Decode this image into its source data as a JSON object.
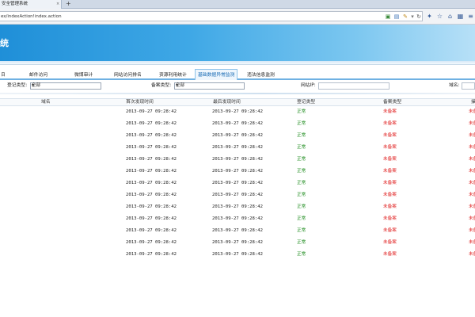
{
  "browser": {
    "tab_title": "安全管理系统",
    "tab_close": "×",
    "new_tab": "+",
    "url": "ex/indexAction!index.action",
    "icons": [
      "shield-icon",
      "bookmark-icon",
      "extension-icon",
      "reload-icon",
      "search-icon",
      "bird-icon",
      "star-icon",
      "home-icon",
      "clipboard-icon",
      "menu-icon"
    ]
  },
  "header": {
    "title": "统",
    "accent": "#2a9be0"
  },
  "nav": {
    "tabs": [
      {
        "label": "日"
      },
      {
        "label": "邮件访问"
      },
      {
        "label": "微博审计"
      },
      {
        "label": "网站访问排名"
      },
      {
        "label": "资源利用统计"
      },
      {
        "label": "基础数据异常监测"
      },
      {
        "label": "违法信息监测"
      }
    ],
    "active_index": 5
  },
  "filters": {
    "reg_type_label": "登记类型:",
    "reg_type_value": "全部",
    "filing_type_label": "备案类型:",
    "filing_type_value": "全部",
    "site_ip_label": "网站IP:",
    "domain_label": "域名:"
  },
  "table": {
    "headers": [
      "域名",
      "首次发现时间",
      "最后发现时间",
      "登记类型",
      "备案类型",
      "操"
    ],
    "rows": [
      {
        "first": "2013-09-27 09:28:42",
        "last": "2013-09-27 09:28:42",
        "reg": "正常",
        "filing": "未备案",
        "op": "未备"
      },
      {
        "first": "2013-09-27 09:28:42",
        "last": "2013-09-27 09:28:42",
        "reg": "正常",
        "filing": "未备案",
        "op": "未备"
      },
      {
        "first": "2013-09-27 09:28:42",
        "last": "2013-09-27 09:28:42",
        "reg": "正常",
        "filing": "未备案",
        "op": "未备"
      },
      {
        "first": "2013-09-27 09:28:42",
        "last": "2013-09-27 09:28:42",
        "reg": "正常",
        "filing": "未备案",
        "op": "未备"
      },
      {
        "first": "2013-09-27 09:28:42",
        "last": "2013-09-27 09:28:42",
        "reg": "正常",
        "filing": "未备案",
        "op": "未备"
      },
      {
        "first": "2013-09-27 09:28:42",
        "last": "2013-09-27 09:28:42",
        "reg": "正常",
        "filing": "未备案",
        "op": "未备"
      },
      {
        "first": "2013-09-27 09:28:42",
        "last": "2013-09-27 09:28:42",
        "reg": "正常",
        "filing": "未备案",
        "op": "未备"
      },
      {
        "first": "2013-09-27 09:28:42",
        "last": "2013-09-27 09:28:42",
        "reg": "正常",
        "filing": "未备案",
        "op": "未备"
      },
      {
        "first": "2013-09-27 09:28:42",
        "last": "2013-09-27 09:28:42",
        "reg": "正常",
        "filing": "未备案",
        "op": "未备"
      },
      {
        "first": "2013-09-27 09:28:42",
        "last": "2013-09-27 09:28:42",
        "reg": "正常",
        "filing": "未备案",
        "op": "未备"
      },
      {
        "first": "2013-09-27 09:28:42",
        "last": "2013-09-27 09:28:42",
        "reg": "正常",
        "filing": "未备案",
        "op": "未备"
      },
      {
        "first": "2013-09-27 09:28:42",
        "last": "2013-09-27 09:28:42",
        "reg": "正常",
        "filing": "未备案",
        "op": "未备"
      },
      {
        "first": "2013-09-27 09:28:42",
        "last": "2013-09-27 09:28:42",
        "reg": "正常",
        "filing": "未备案",
        "op": "未备"
      }
    ],
    "colors": {
      "normal": "#1a8a1a",
      "unfiled": "#e02020"
    }
  }
}
